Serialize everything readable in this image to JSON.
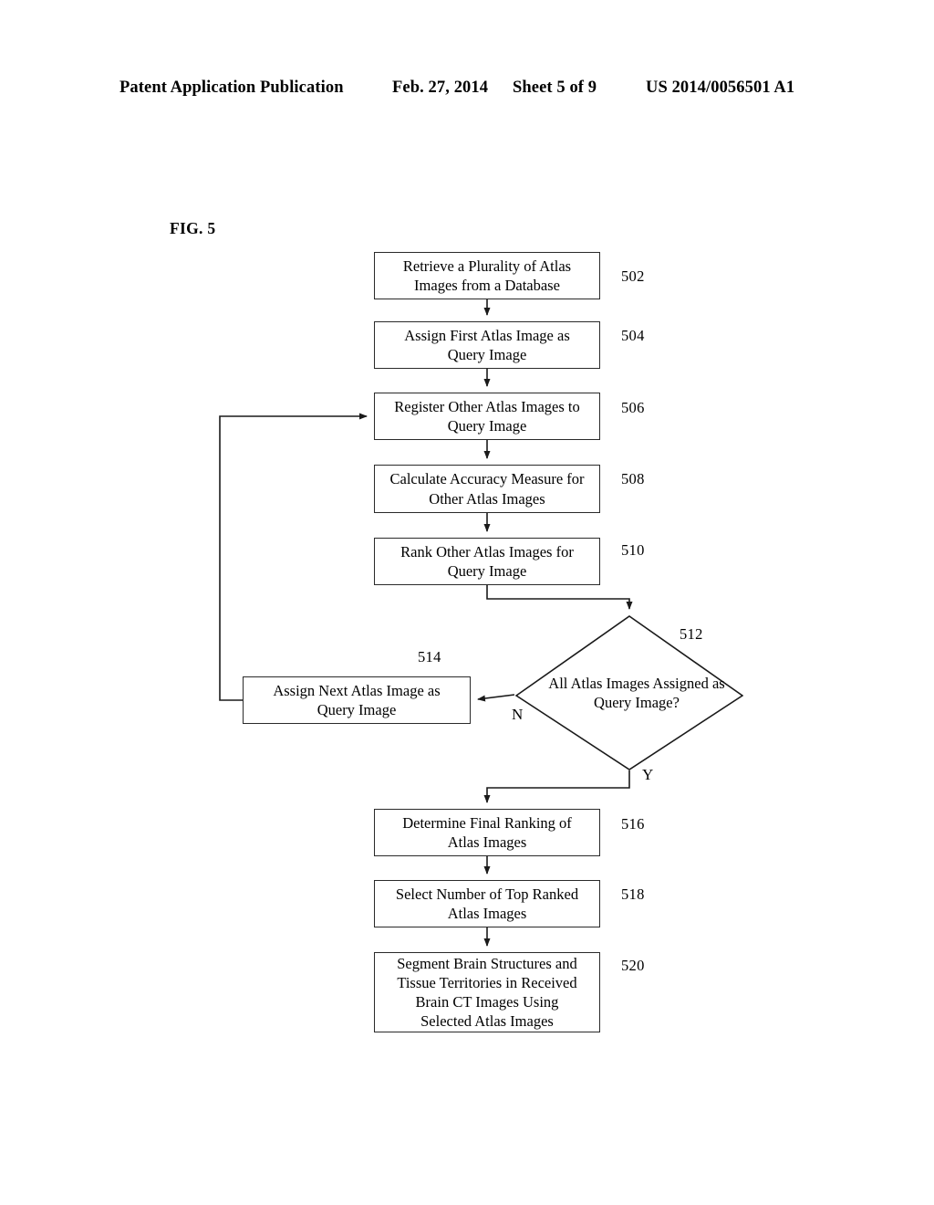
{
  "header": {
    "publication": "Patent Application Publication",
    "date": "Feb. 27, 2014",
    "sheet": "Sheet 5 of 9",
    "patent_number": "US 2014/0056501 A1"
  },
  "figure": {
    "label": "FIG. 5"
  },
  "flowchart": {
    "nodes": [
      {
        "id": "502",
        "ref": "502",
        "type": "process",
        "line1": "Retrieve a Plurality of Atlas",
        "line2": "Images from a Database",
        "line3": "",
        "line4": ""
      },
      {
        "id": "504",
        "ref": "504",
        "type": "process",
        "line1": "Assign First Atlas Image as",
        "line2": "Query Image",
        "line3": "",
        "line4": ""
      },
      {
        "id": "506",
        "ref": "506",
        "type": "process",
        "line1": "Register Other Atlas Images to",
        "line2": "Query Image",
        "line3": "",
        "line4": ""
      },
      {
        "id": "508",
        "ref": "508",
        "type": "process",
        "line1": "Calculate Accuracy Measure for",
        "line2": "Other Atlas Images",
        "line3": "",
        "line4": ""
      },
      {
        "id": "510",
        "ref": "510",
        "type": "process",
        "line1": "Rank Other Atlas Images for",
        "line2": "Query Image",
        "line3": "",
        "line4": ""
      },
      {
        "id": "512",
        "ref": "512",
        "type": "decision",
        "line1": "All Atlas",
        "line2": "Images",
        "line3": "Assigned as",
        "line4": "Query Image?"
      },
      {
        "id": "514",
        "ref": "514",
        "type": "process",
        "line1": "Assign Next Atlas Image as",
        "line2": "Query Image",
        "line3": "",
        "line4": ""
      },
      {
        "id": "516",
        "ref": "516",
        "type": "process",
        "line1": "Determine Final Ranking of",
        "line2": "Atlas Images",
        "line3": "",
        "line4": ""
      },
      {
        "id": "518",
        "ref": "518",
        "type": "process",
        "line1": "Select Number of Top Ranked",
        "line2": "Atlas Images",
        "line3": "",
        "line4": ""
      },
      {
        "id": "520",
        "ref": "520",
        "type": "process",
        "line1": "Segment Brain Structures and",
        "line2": "Tissue Territories in Received",
        "line3": "Brain CT Images Using",
        "line4": "Selected Atlas Images"
      }
    ],
    "branch_labels": {
      "no": "N",
      "yes": "Y"
    },
    "line_color": "#1a1a1a"
  }
}
